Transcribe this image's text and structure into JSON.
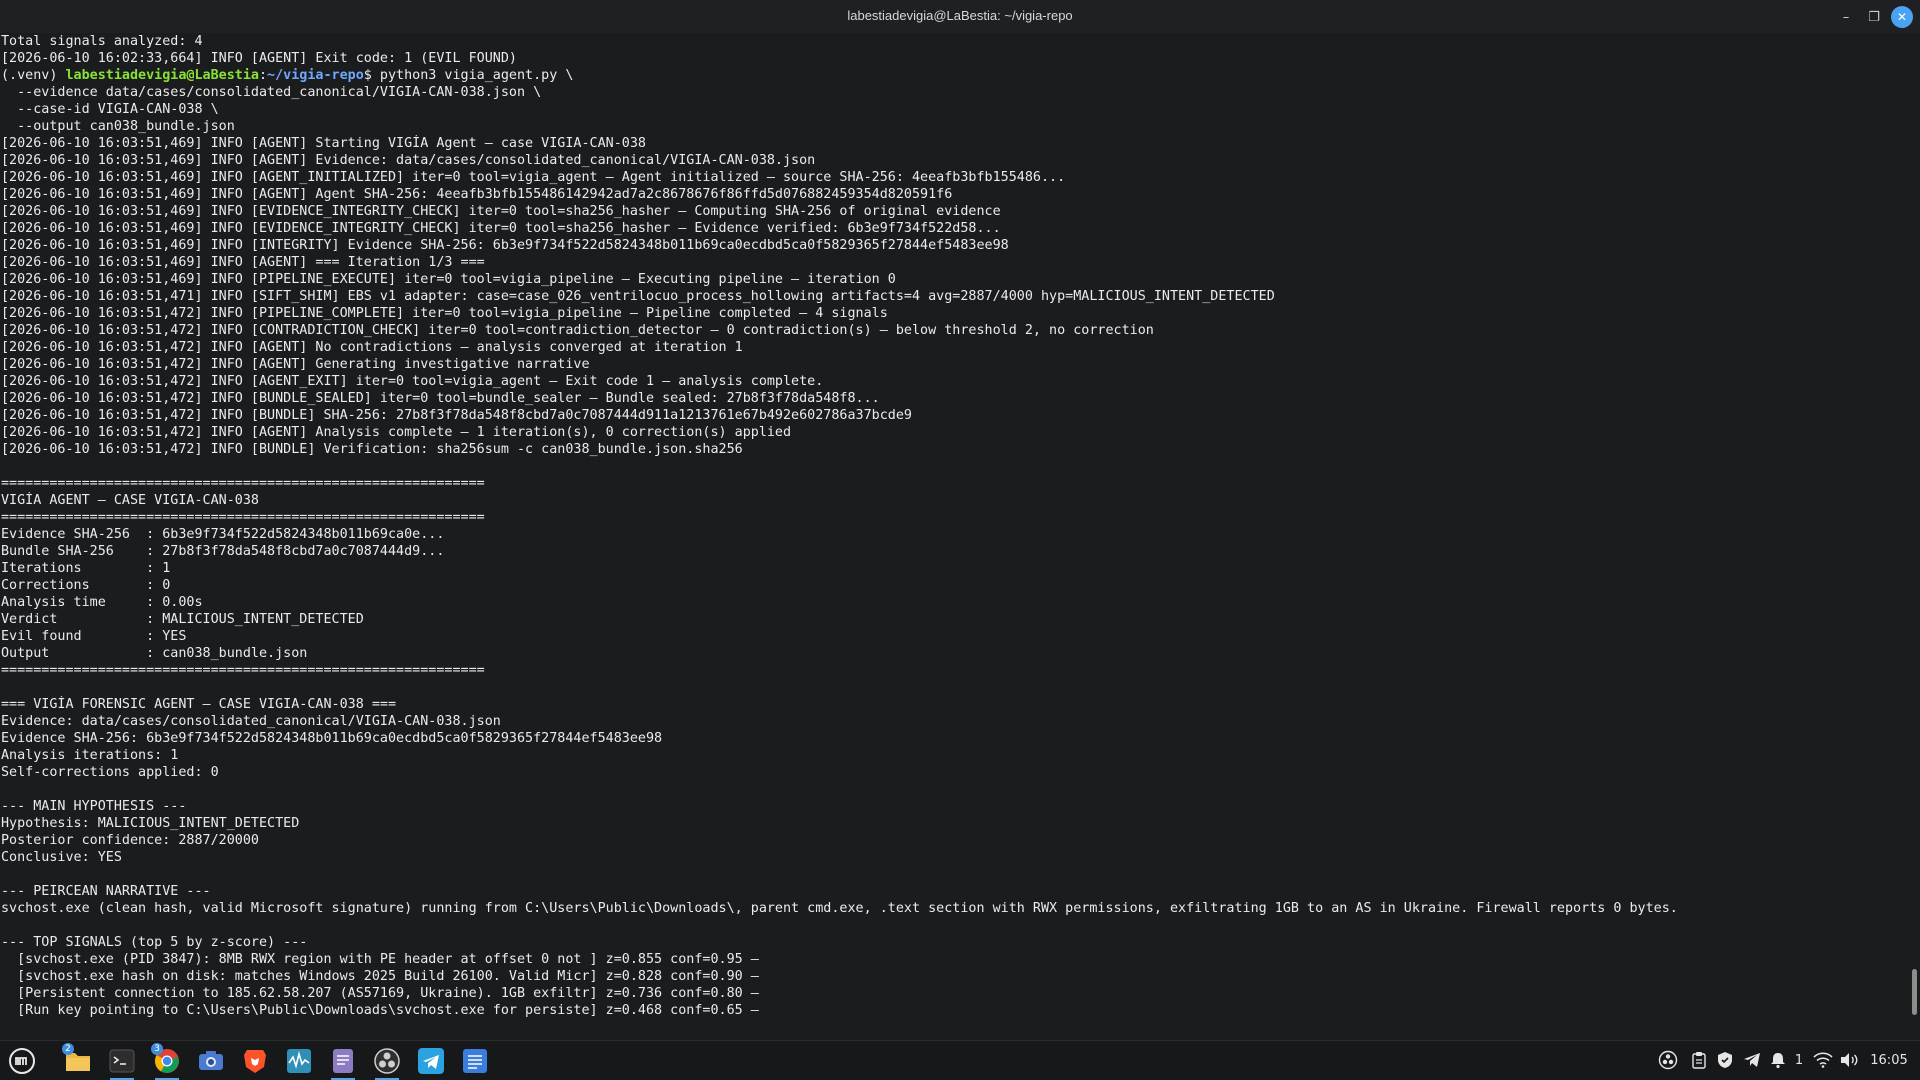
{
  "window": {
    "title": "labestiadevigia@LaBestia: ~/vigia-repo"
  },
  "terminal": {
    "lines": [
      {
        "text": "Total signals analyzed: 4"
      },
      {
        "text": "[2026-06-10 16:02:33,664] INFO [AGENT] Exit code: 1 (EVIL FOUND)"
      },
      {
        "prompt": {
          "venv": "(.venv) ",
          "user": "labestiadevigia@LaBestia",
          "sep": ":",
          "path": "~/vigia-repo",
          "dollar": "$ ",
          "cmd": "python3 vigia_agent.py \\"
        }
      },
      {
        "text": "  --evidence data/cases/consolidated_canonical/VIGIA-CAN-038.json \\"
      },
      {
        "text": "  --case-id VIGIA-CAN-038 \\"
      },
      {
        "text": "  --output can038_bundle.json"
      },
      {
        "text": "[2026-06-10 16:03:51,469] INFO [AGENT] Starting VIGÍA Agent — case VIGIA-CAN-038"
      },
      {
        "text": "[2026-06-10 16:03:51,469] INFO [AGENT] Evidence: data/cases/consolidated_canonical/VIGIA-CAN-038.json"
      },
      {
        "text": "[2026-06-10 16:03:51,469] INFO [AGENT_INITIALIZED] iter=0 tool=vigia_agent — Agent initialized — source SHA-256: 4eeafb3bfb155486..."
      },
      {
        "text": "[2026-06-10 16:03:51,469] INFO [AGENT] Agent SHA-256: 4eeafb3bfb155486142942ad7a2c8678676f86ffd5d076882459354d820591f6"
      },
      {
        "text": "[2026-06-10 16:03:51,469] INFO [EVIDENCE_INTEGRITY_CHECK] iter=0 tool=sha256_hasher — Computing SHA-256 of original evidence"
      },
      {
        "text": "[2026-06-10 16:03:51,469] INFO [EVIDENCE_INTEGRITY_CHECK] iter=0 tool=sha256_hasher — Evidence verified: 6b3e9f734f522d58..."
      },
      {
        "text": "[2026-06-10 16:03:51,469] INFO [INTEGRITY] Evidence SHA-256: 6b3e9f734f522d5824348b011b69ca0ecdbd5ca0f5829365f27844ef5483ee98"
      },
      {
        "text": "[2026-06-10 16:03:51,469] INFO [AGENT] === Iteration 1/3 ==="
      },
      {
        "text": "[2026-06-10 16:03:51,469] INFO [PIPELINE_EXECUTE] iter=0 tool=vigia_pipeline — Executing pipeline — iteration 0"
      },
      {
        "text": "[2026-06-10 16:03:51,471] INFO [SIFT_SHIM] EBS v1 adapter: case=case_026_ventrilocuo_process_hollowing artifacts=4 avg=2887/4000 hyp=MALICIOUS_INTENT_DETECTED"
      },
      {
        "text": "[2026-06-10 16:03:51,472] INFO [PIPELINE_COMPLETE] iter=0 tool=vigia_pipeline — Pipeline completed — 4 signals"
      },
      {
        "text": "[2026-06-10 16:03:51,472] INFO [CONTRADICTION_CHECK] iter=0 tool=contradiction_detector — 0 contradiction(s) — below threshold 2, no correction"
      },
      {
        "text": "[2026-06-10 16:03:51,472] INFO [AGENT] No contradictions — analysis converged at iteration 1"
      },
      {
        "text": "[2026-06-10 16:03:51,472] INFO [AGENT] Generating investigative narrative"
      },
      {
        "text": "[2026-06-10 16:03:51,472] INFO [AGENT_EXIT] iter=0 tool=vigia_agent — Exit code 1 — analysis complete."
      },
      {
        "text": "[2026-06-10 16:03:51,472] INFO [BUNDLE_SEALED] iter=0 tool=bundle_sealer — Bundle sealed: 27b8f3f78da548f8..."
      },
      {
        "text": "[2026-06-10 16:03:51,472] INFO [BUNDLE] SHA-256: 27b8f3f78da548f8cbd7a0c7087444d911a1213761e67b492e602786a37bcde9"
      },
      {
        "text": "[2026-06-10 16:03:51,472] INFO [AGENT] Analysis complete — 1 iteration(s), 0 correction(s) applied"
      },
      {
        "text": "[2026-06-10 16:03:51,472] INFO [BUNDLE] Verification: sha256sum -c can038_bundle.json.sha256"
      },
      {
        "text": ""
      },
      {
        "text": "============================================================"
      },
      {
        "text": "VIGÍA AGENT — CASE VIGIA-CAN-038"
      },
      {
        "text": "============================================================"
      },
      {
        "text": "Evidence SHA-256  : 6b3e9f734f522d5824348b011b69ca0e..."
      },
      {
        "text": "Bundle SHA-256    : 27b8f3f78da548f8cbd7a0c7087444d9..."
      },
      {
        "text": "Iterations        : 1"
      },
      {
        "text": "Corrections       : 0"
      },
      {
        "text": "Analysis time     : 0.00s"
      },
      {
        "text": "Verdict           : MALICIOUS_INTENT_DETECTED"
      },
      {
        "text": "Evil found        : YES"
      },
      {
        "text": "Output            : can038_bundle.json"
      },
      {
        "text": "============================================================"
      },
      {
        "text": ""
      },
      {
        "text": "=== VIGÍA FORENSIC AGENT — CASE VIGIA-CAN-038 ==="
      },
      {
        "text": "Evidence: data/cases/consolidated_canonical/VIGIA-CAN-038.json"
      },
      {
        "text": "Evidence SHA-256: 6b3e9f734f522d5824348b011b69ca0ecdbd5ca0f5829365f27844ef5483ee98"
      },
      {
        "text": "Analysis iterations: 1"
      },
      {
        "text": "Self-corrections applied: 0"
      },
      {
        "text": ""
      },
      {
        "text": "--- MAIN HYPOTHESIS ---"
      },
      {
        "text": "Hypothesis: MALICIOUS_INTENT_DETECTED"
      },
      {
        "text": "Posterior confidence: 2887/20000"
      },
      {
        "text": "Conclusive: YES"
      },
      {
        "text": ""
      },
      {
        "text": "--- PEIRCEAN NARRATIVE ---"
      },
      {
        "text": "svchost.exe (clean hash, valid Microsoft signature) running from C:\\Users\\Public\\Downloads\\, parent cmd.exe, .text section with RWX permissions, exfiltrating 1GB to an AS in Ukraine. Firewall reports 0 bytes."
      },
      {
        "text": ""
      },
      {
        "text": "--- TOP SIGNALS (top 5 by z-score) ---"
      },
      {
        "text": "  [svchost.exe (PID 3847): 8MB RWX region with PE header at offset 0 not ] z=0.855 conf=0.95 —"
      },
      {
        "text": "  [svchost.exe hash on disk: matches Windows 2025 Build 26100. Valid Micr] z=0.828 conf=0.90 —"
      },
      {
        "text": "  [Persistent connection to 185.62.58.207 (AS57169, Ukraine). 1GB exfiltr] z=0.736 conf=0.80 —"
      },
      {
        "text": "  [Run key pointing to C:\\Users\\Public\\Downloads\\svchost.exe for persiste] z=0.468 conf=0.65 —"
      }
    ]
  },
  "taskbar": {
    "apps": [
      {
        "name": "menu-icon"
      },
      {
        "name": "file-manager-icon",
        "badge": "2"
      },
      {
        "name": "terminal-icon"
      },
      {
        "name": "chrome-icon",
        "badge": "3"
      },
      {
        "name": "camera-icon"
      },
      {
        "name": "brave-icon"
      },
      {
        "name": "system-monitor-icon"
      },
      {
        "name": "text-editor-icon"
      },
      {
        "name": "obs-icon"
      },
      {
        "name": "telegram-icon"
      },
      {
        "name": "notes-icon"
      }
    ],
    "tray": {
      "notification_count": "1",
      "clock": "16:05"
    }
  },
  "colors": {
    "background": "#1b1c1e",
    "text": "#ebebeb",
    "prompt_user": "#8ae234",
    "prompt_path": "#6fa8ff",
    "accent": "#3d8fdb"
  }
}
